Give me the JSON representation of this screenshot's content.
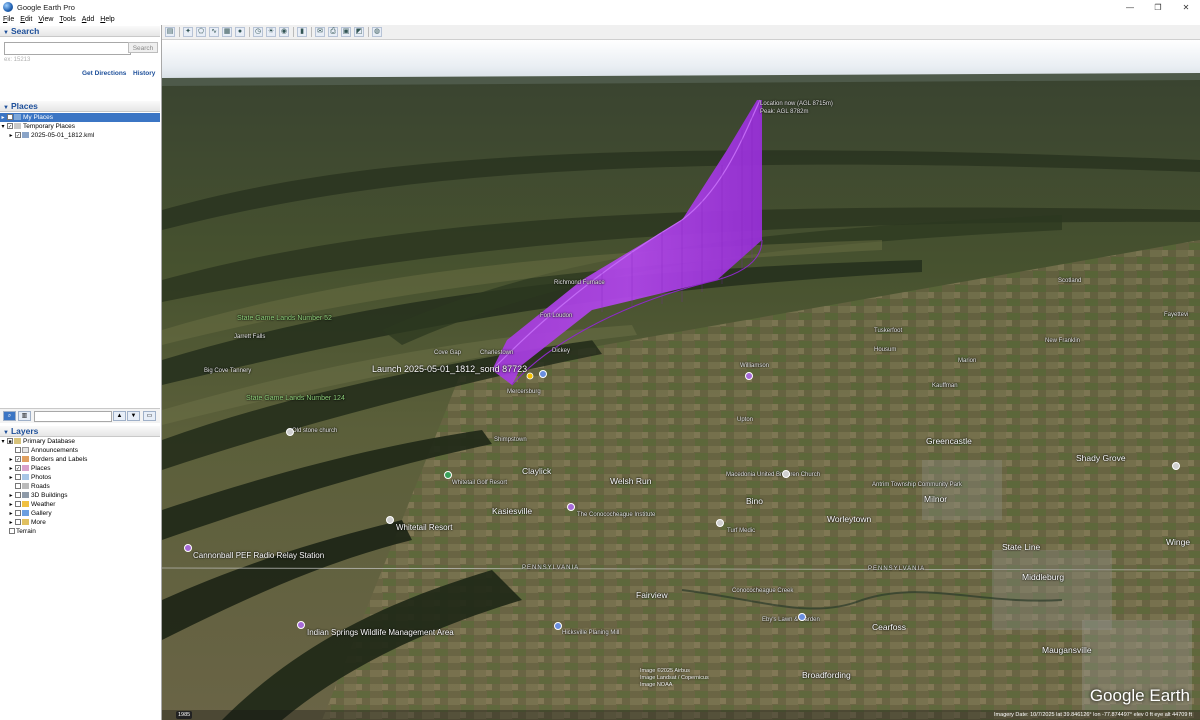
{
  "window": {
    "title": "Google Earth Pro",
    "minimize": "—",
    "maximize": "❐",
    "close": "✕"
  },
  "menu": [
    "File",
    "Edit",
    "View",
    "Tools",
    "Add",
    "Help"
  ],
  "search": {
    "heading": "Search",
    "placeholder": "",
    "button": "Search",
    "hint": "ex: 15213",
    "get_directions": "Get Directions",
    "history": "History"
  },
  "places": {
    "heading": "Places",
    "items": [
      {
        "label": "My Places",
        "selected": true
      },
      {
        "label": "Temporary Places",
        "selected": false
      },
      {
        "label": "2025-05-01_1812.kml",
        "selected": false
      }
    ]
  },
  "layers": {
    "heading": "Layers",
    "items": [
      "Primary Database",
      "Announcements",
      "Borders and Labels",
      "Places",
      "Photos",
      "Roads",
      "3D Buildings",
      "Weather",
      "Gallery",
      "More",
      "Terrain"
    ]
  },
  "map": {
    "balloon_labels": {
      "top1": "Location now (AGL 8715m)",
      "top2": "Peak: AGL 8782m",
      "launch": "Launch 2025-05-01_1812_sond 87723"
    },
    "places": {
      "state_game_lands_52": "State Game Lands Number 52",
      "jarrett_falls": "Jarrett Falls",
      "big_cove_tannery": "Big Cove Tannery",
      "state_game_lands_124": "State Game Lands Number 124",
      "old_stone_church": "Old stone church",
      "cove_gap": "Cove Gap",
      "charlestown": "Charlestown",
      "dickey": "Dickey",
      "fort_loudon": "Fort Loudon",
      "richmond_furnace": "Richmond Furnace",
      "mercersburg": "Mercersburg",
      "williamson": "Williamson",
      "upton": "Upton",
      "shimpstown": "Shimpstown",
      "claylick": "Claylick",
      "welsh_run": "Welsh Run",
      "whitetail_golf": "Whitetail Golf Resort",
      "whitetail_resort": "Whitetail Resort",
      "kasiesville": "Kasiesville",
      "conococheague_institute": "The Conococheague Institute",
      "bino": "Bino",
      "turf_medic": "Turf Medic",
      "worleytown": "Worleytown",
      "macedonia": "Macedonia United Brethren Church",
      "antrim": "Antrim Township Community Park",
      "greencastle": "Greencastle",
      "kauffman": "Kauffman",
      "marion": "Marion",
      "new_franklin": "New Franklin",
      "housum": "Housum",
      "shady_grove": "Shady Grove",
      "milnor": "Milnor",
      "state_line": "State Line",
      "winge": "Winge",
      "middleburg": "Middleburg",
      "cannonball": "Cannonball PEF Radio Relay Station",
      "pennsylvania_left": "PENNSYLVANIA",
      "pennsylvania_right": "PENNSYLVANIA",
      "fairview": "Fairview",
      "conococheague_creek": "Conococheague Creek",
      "indian_springs": "Indian Springs Wildlife Management Area",
      "hicksville": "Hicksville Planing Mill",
      "eby": "Eby's Lawn & Garden",
      "cearfoss": "Cearfoss",
      "broadfording": "Broadfording",
      "maugansville": "Maugansville",
      "scotland": "Scotland",
      "fayetteville": "Fayettevi",
      "tuskerfoot": "Tuskerfoot"
    },
    "copyright": [
      "Image ©2025 Airbus",
      "Image Landsat / Copernicus",
      "Image NOAA"
    ],
    "brand": "Google Earth",
    "status": {
      "year": "1985",
      "coords": "Imagery Date: 10/7/2025    lat  39.846126°  lon  -77.874497°  elev   0 ft   eye alt  44709 ft"
    }
  }
}
